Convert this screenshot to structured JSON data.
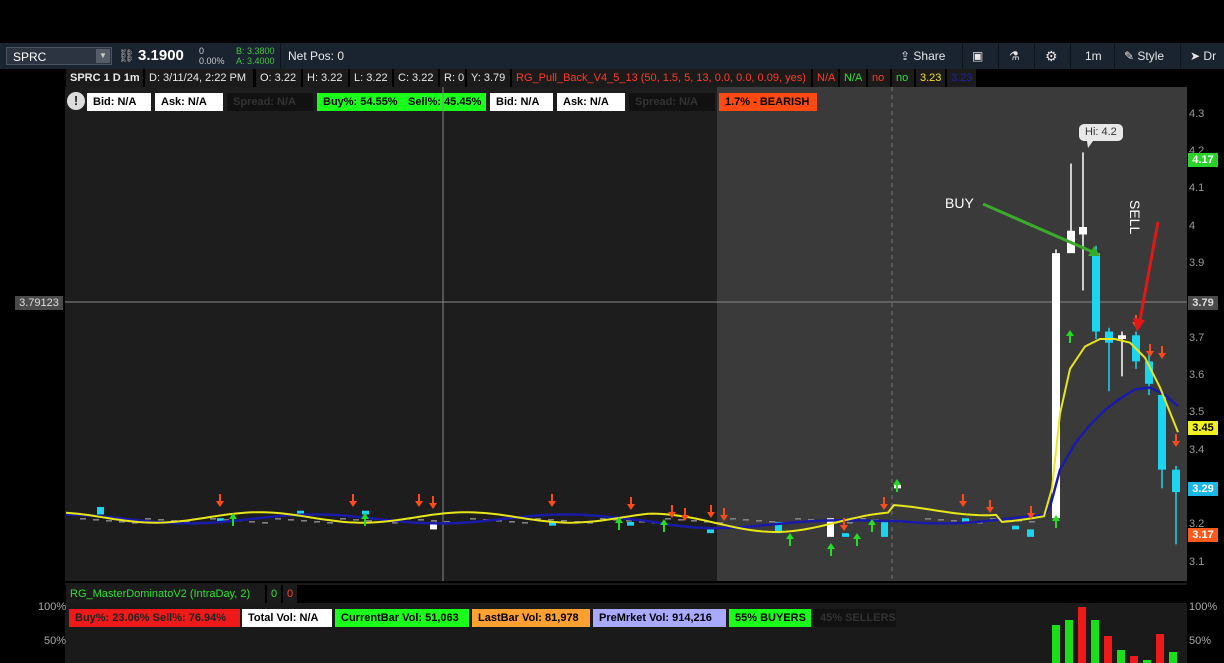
{
  "toolbar": {
    "symbol": "SPRC",
    "last_price": "3.1900",
    "change": "0",
    "change_pct": "0.00%",
    "bid_label": "B: 3.3800",
    "ask_label": "A: 3.4000",
    "net_pos": "Net Pos: 0",
    "share": "Share",
    "timeframe": "1m",
    "style": "Style",
    "draw": "Dr"
  },
  "header": {
    "title": "SPRC 1 D 1m",
    "date": "D: 3/11/24, 2:22 PM",
    "open": "O: 3.22",
    "high": "H: 3.22",
    "low": "L: 3.22",
    "close": "C: 3.22",
    "range": "R: 0",
    "y": "Y: 3.79",
    "study": "RG_Pull_Back_V4_5_13 (50, 1.5, 5, 13, 0.0, 0.0, 0.09, yes)",
    "flags": [
      "N/A",
      "N/A",
      "no",
      "no",
      "3.23",
      "3.23"
    ]
  },
  "labels": {
    "bid1": "Bid: N/A",
    "ask1": "Ask: N/A",
    "spread1": "Spread: N/A",
    "buy_pct": "Buy%: 54.55%",
    "sell_pct": "Sell%: 45.45%",
    "bid2": "Bid: N/A",
    "ask2": "Ask: N/A",
    "spread2": "Spread: N/A",
    "bearish": "1.7% - BEARISH"
  },
  "annotations": {
    "hi_bubble": "Hi: 4.2",
    "buy": "BUY",
    "sell": "SELL",
    "crosshair_price": "3.79123"
  },
  "yaxis": {
    "ticks": [
      "4.3",
      "4.2",
      "4.1",
      "4",
      "3.9",
      "3.8",
      "3.7",
      "3.6",
      "3.5",
      "3.4",
      "3.3",
      "3.2",
      "3.1"
    ],
    "flag_417": "4.17",
    "flag_379": "3.79",
    "flag_345": "3.45",
    "flag_329": "3.29",
    "flag_317": "3.17"
  },
  "lower": {
    "study": "RG_MasterDominatoV2 (IntraDay, 2)",
    "v0a": "0",
    "v0b": "0",
    "buy_sell": "Buy%: 23.06%   Sell%: 76.94%",
    "total_vol": "Total Vol: N/A",
    "current_bar": "CurrentBar Vol: 51,063",
    "last_bar": "LastBar Vol: 81,978",
    "premarket": "PreMrket Vol: 914,216",
    "buyers": "55% BUYERS",
    "sellers": "45% SELLERS",
    "pct100": "100%",
    "pct50": "50%"
  },
  "colors": {
    "ema_fast": "#e6e61a",
    "ema_slow": "#1a1aa8",
    "candle_up": "#ffffff",
    "candle_down": "#1ad4f0",
    "arrow_up": "#22dd22",
    "arrow_down": "#ff4a1a"
  }
}
